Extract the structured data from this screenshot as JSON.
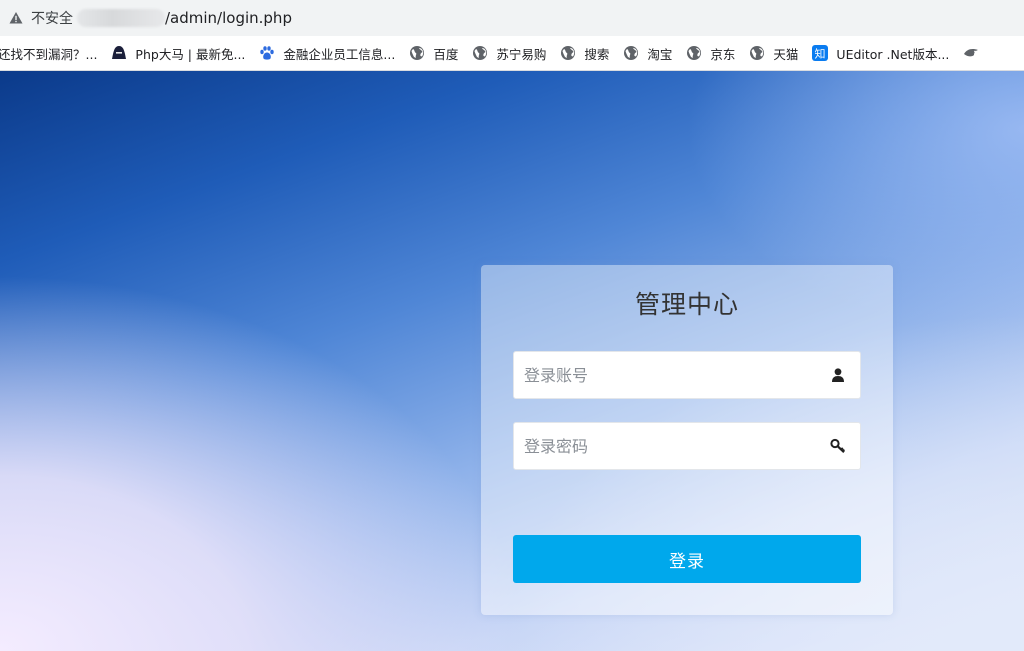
{
  "browser": {
    "insecure_label": "不安全",
    "url_path": "/admin/login.php",
    "warning_icon": "warning-triangle-icon"
  },
  "bookmarks": [
    {
      "label": "还找不到漏洞？...",
      "icon": "none"
    },
    {
      "label": "Php大马 | 最新免...",
      "icon": "hacker-icon"
    },
    {
      "label": "金融企业员工信息...",
      "icon": "paw-icon"
    },
    {
      "label": "百度",
      "icon": "globe-icon"
    },
    {
      "label": "苏宁易购",
      "icon": "globe-icon"
    },
    {
      "label": "搜索",
      "icon": "globe-icon"
    },
    {
      "label": "淘宝",
      "icon": "globe-icon"
    },
    {
      "label": "京东",
      "icon": "globe-icon"
    },
    {
      "label": "天猫",
      "icon": "globe-icon"
    },
    {
      "label": "UEditor .Net版本...",
      "icon": "zhihu-icon",
      "icon_text": "知"
    }
  ],
  "login": {
    "title": "管理中心",
    "username_placeholder": "登录账号",
    "password_placeholder": "登录密码",
    "submit_label": "登录",
    "username_icon": "user-icon",
    "password_icon": "key-icon",
    "accent_color": "#00a8ec"
  }
}
